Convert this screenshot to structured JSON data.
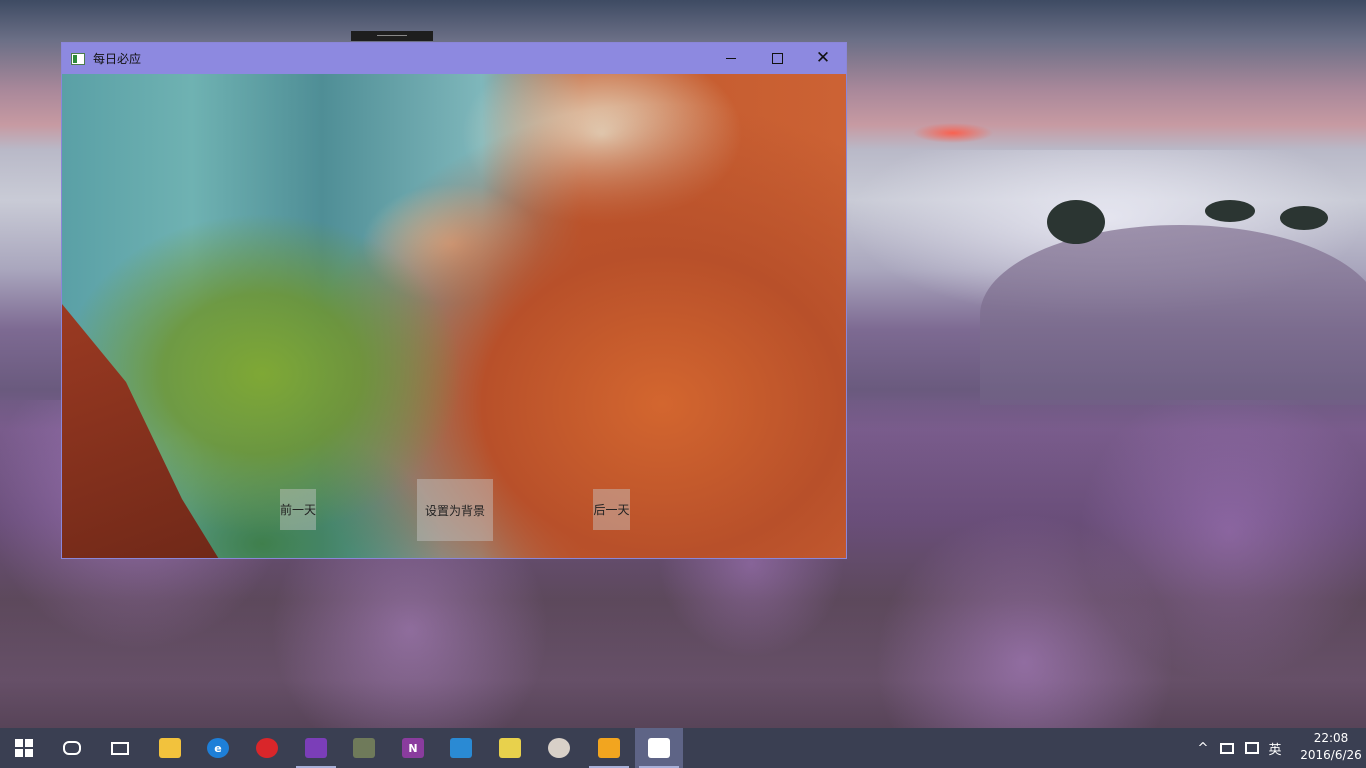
{
  "window": {
    "title": "每日必应",
    "controls": {
      "minimize_icon": "minimize-icon",
      "maximize_icon": "maximize-icon",
      "close_icon": "close-icon",
      "close_glyph": "✕"
    },
    "buttons": {
      "previous_day": "前一天",
      "set_as_background": "设置为背景",
      "next_day": "后一天"
    }
  },
  "taskbar": {
    "items": [
      {
        "name": "start-icon"
      },
      {
        "name": "cortana-icon"
      },
      {
        "name": "task-view-icon"
      },
      {
        "name": "file-explorer-icon",
        "color": "#f2c23d"
      },
      {
        "name": "edge-icon",
        "color": "#1e7fd8"
      },
      {
        "name": "netease-music-icon",
        "color": "#d9262a"
      },
      {
        "name": "visual-studio-icon",
        "color": "#7b3eb8",
        "running": true
      },
      {
        "name": "tool-app-icon",
        "color": "#6f7a5a"
      },
      {
        "name": "onenote-icon",
        "color": "#8a3c9e",
        "glyph": "N"
      },
      {
        "name": "vscode-icon",
        "color": "#2a8ad4"
      },
      {
        "name": "notes-app-icon",
        "color": "#e8d14c"
      },
      {
        "name": "paint-app-icon",
        "color": "#d8d0c8"
      },
      {
        "name": "window-app-icon",
        "color": "#f2a51f"
      },
      {
        "name": "bing-daily-app-icon",
        "color": "#ffffff",
        "active": true
      }
    ],
    "tray": {
      "show_hidden_icon": "^",
      "network_icon": "network-icon",
      "action_center_icon": "message-icon",
      "ime_indicator": "英"
    },
    "clock": {
      "time": "22:08",
      "date": "2016/6/26"
    }
  },
  "colors": {
    "titlebar": "#8d89e0",
    "taskbar": "#3a3f52"
  }
}
